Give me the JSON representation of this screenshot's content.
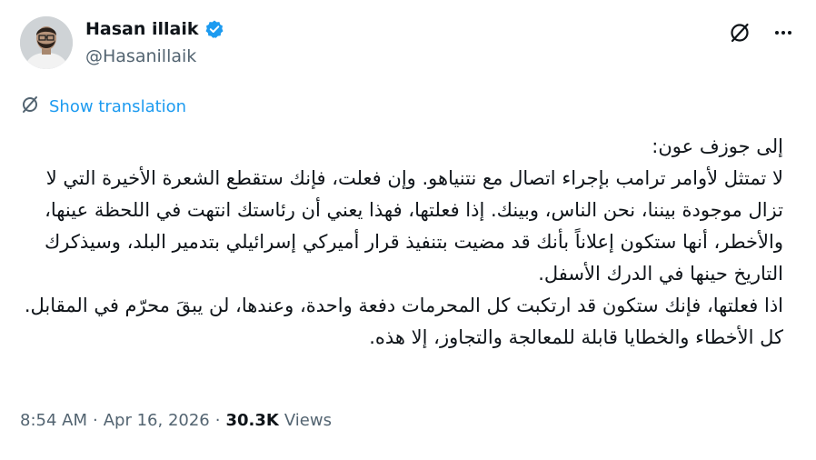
{
  "author": {
    "display_name": "Hasan illaik",
    "handle": "@Hasanillaik",
    "verified": true,
    "verified_color": "#1d9bf0"
  },
  "header": {
    "grok_icon": "slashed-circle-icon",
    "more_icon": "more-dots-icon"
  },
  "translation": {
    "label": "Show translation",
    "icon": "translate-icon"
  },
  "tweet": {
    "text": "إلى جوزف عون:\nلا تمتثل لأوامر ترامب بإجراء اتصال مع نتنياهو. وإن فعلت، فإنك ستقطع الشعرة الأخيرة التي لا تزال موجودة بيننا، نحن الناس، وبينك. إذا فعلتها، فهذا يعني أن رئاستك انتهت في اللحظة عينها، والأخطر، أنها ستكون إعلاناً بأنك قد مضيت بتنفيذ قرار أميركي إسرائيلي بتدمير البلد، وسيذكرك التاريخ حينها في الدرك الأسفل.\nاذا فعلتها، فإنك ستكون قد ارتكبت كل المحرمات دفعة واحدة، وعندها، لن يبقَ محرّم في المقابل.\nكل الأخطاء والخطايا قابلة للمعالجة والتجاوز، إلا هذه."
  },
  "meta": {
    "time": "8:54 AM",
    "separator": "·",
    "date": "Apr 16, 2026",
    "views_count": "30.3K",
    "views_label": "Views"
  },
  "colors": {
    "accent": "#1d9bf0",
    "text_primary": "#0f1419",
    "text_secondary": "#536471"
  }
}
